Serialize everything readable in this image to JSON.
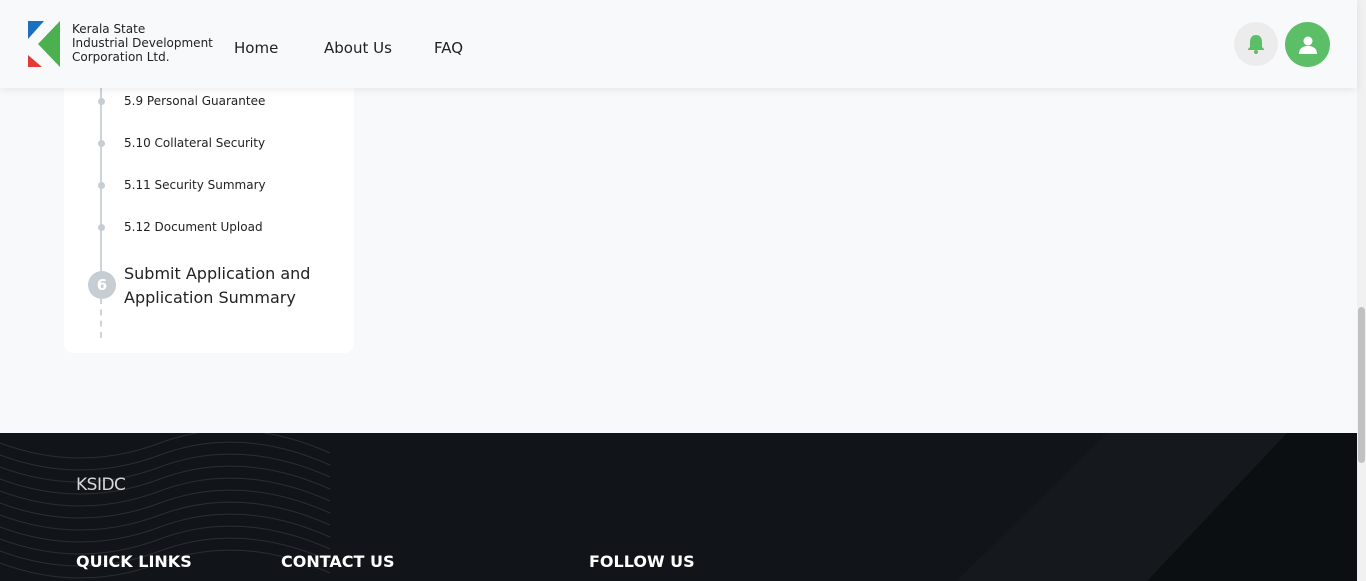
{
  "header": {
    "brand_lines": [
      "Kerala State",
      "Industrial Development",
      "Corporation Ltd."
    ],
    "nav": {
      "home": "Home",
      "about": "About Us",
      "faq": "FAQ"
    },
    "icons": {
      "notifications": "bell-icon",
      "profile": "user-icon"
    },
    "colors": {
      "accent_green": "#5cbf68",
      "logo_blue": "#1a6fbf",
      "logo_green": "#4caf50",
      "logo_red": "#e53935"
    }
  },
  "stepper": {
    "substeps": [
      {
        "label": "5.9 Personal Guarantee"
      },
      {
        "label": "5.10 Collateral Security"
      },
      {
        "label": "5.11 Security Summary"
      },
      {
        "label": "5.12 Document Upload"
      }
    ],
    "step6": {
      "number": "6",
      "title_line1": "Submit Application and",
      "title_line2": "Application Summary"
    }
  },
  "footer": {
    "brand": "KSIDC",
    "headings": {
      "quick_links": "QUICK LINKS",
      "contact_us": "CONTACT US",
      "follow_us": "FOLLOW US"
    }
  }
}
